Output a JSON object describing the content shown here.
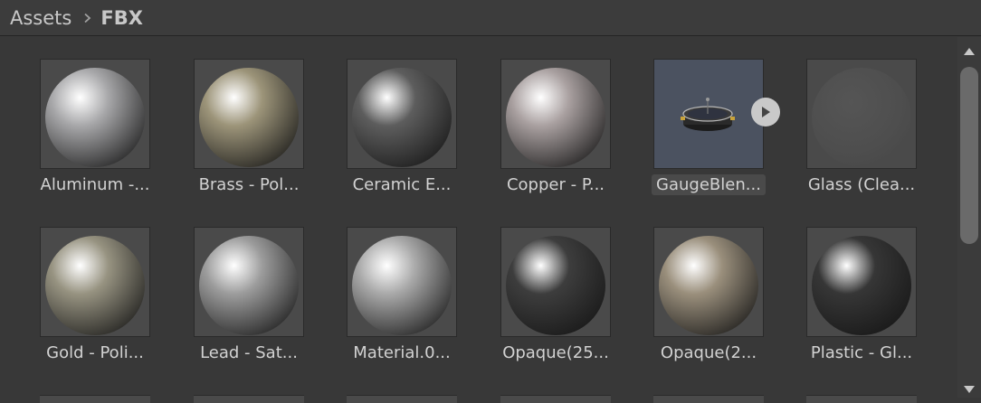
{
  "breadcrumb": {
    "parent": "Assets",
    "current": "FBX"
  },
  "assets": [
    {
      "label": "Aluminum -...",
      "kind": "sphere",
      "color": "#a7a7a9"
    },
    {
      "label": "Brass - Pol...",
      "kind": "sphere",
      "color": "#9c9479"
    },
    {
      "label": "Ceramic E...",
      "kind": "sphere",
      "color": "#5d5d5d"
    },
    {
      "label": "Copper - P...",
      "kind": "sphere",
      "color": "#a9a0a0"
    },
    {
      "label": "GaugeBlen...",
      "kind": "model",
      "selected": true
    },
    {
      "label": "Glass (Clea...",
      "kind": "glass",
      "color": "#4e4e4e"
    },
    {
      "label": "Gold - Poli...",
      "kind": "sphere",
      "color": "#979381"
    },
    {
      "label": "Lead - Sat...",
      "kind": "sphere",
      "color": "#9c9c9c"
    },
    {
      "label": "Material.0...",
      "kind": "sphere",
      "color": "#a9a9a9"
    },
    {
      "label": "Opaque(25...",
      "kind": "sphere",
      "color": "#3d3d3d"
    },
    {
      "label": "Opaque(2...",
      "kind": "sphere",
      "color": "#9a8f7c"
    },
    {
      "label": "Plastic - Gl...",
      "kind": "sphere",
      "color": "#363636"
    }
  ]
}
